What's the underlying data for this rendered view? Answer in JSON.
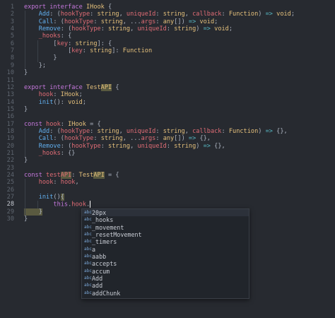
{
  "editor": {
    "active_line": 28,
    "lines": [
      {
        "n": "1",
        "s": [
          {
            "c": "kw",
            "t": "export interface "
          },
          {
            "c": "ty",
            "t": "IHook"
          },
          {
            "c": "pu",
            "t": " {"
          }
        ]
      },
      {
        "n": "2",
        "s": [
          {
            "c": "fn",
            "t": "    Add"
          },
          {
            "c": "pu",
            "t": ": ("
          },
          {
            "c": "pr",
            "t": "hookType"
          },
          {
            "c": "pu",
            "t": ": "
          },
          {
            "c": "ty",
            "t": "string"
          },
          {
            "c": "pu",
            "t": ", "
          },
          {
            "c": "pr",
            "t": "uniqueId"
          },
          {
            "c": "pu",
            "t": ": "
          },
          {
            "c": "ty",
            "t": "string"
          },
          {
            "c": "pu",
            "t": ", "
          },
          {
            "c": "pr",
            "t": "callback"
          },
          {
            "c": "pu",
            "t": ": "
          },
          {
            "c": "ty",
            "t": "Function"
          },
          {
            "c": "pu",
            "t": ") "
          },
          {
            "c": "op",
            "t": "=>"
          },
          {
            "c": "ty",
            "t": " void"
          },
          {
            "c": "pu",
            "t": ";"
          }
        ]
      },
      {
        "n": "3",
        "s": [
          {
            "c": "fn",
            "t": "    Call"
          },
          {
            "c": "pu",
            "t": ": ("
          },
          {
            "c": "pr",
            "t": "hookType"
          },
          {
            "c": "pu",
            "t": ": "
          },
          {
            "c": "ty",
            "t": "string"
          },
          {
            "c": "pu",
            "t": ", ..."
          },
          {
            "c": "pr",
            "t": "args"
          },
          {
            "c": "pu",
            "t": ": "
          },
          {
            "c": "ty",
            "t": "any"
          },
          {
            "c": "pu",
            "t": "[]) "
          },
          {
            "c": "op",
            "t": "=>"
          },
          {
            "c": "ty",
            "t": " void"
          },
          {
            "c": "pu",
            "t": ";"
          }
        ]
      },
      {
        "n": "4",
        "s": [
          {
            "c": "fn",
            "t": "    Remove"
          },
          {
            "c": "pu",
            "t": ": ("
          },
          {
            "c": "pr",
            "t": "hookType"
          },
          {
            "c": "pu",
            "t": ": "
          },
          {
            "c": "ty",
            "t": "string"
          },
          {
            "c": "pu",
            "t": ", "
          },
          {
            "c": "pr",
            "t": "uniqueId"
          },
          {
            "c": "pu",
            "t": ": "
          },
          {
            "c": "ty",
            "t": "string"
          },
          {
            "c": "pu",
            "t": ") "
          },
          {
            "c": "op",
            "t": "=>"
          },
          {
            "c": "ty",
            "t": " void"
          },
          {
            "c": "pu",
            "t": ";"
          }
        ]
      },
      {
        "n": "5",
        "s": [
          {
            "c": "pr",
            "t": "    _hooks"
          },
          {
            "c": "pu",
            "t": ": {"
          }
        ]
      },
      {
        "n": "6",
        "s": [
          {
            "c": "pu",
            "t": "        ["
          },
          {
            "c": "pr",
            "t": "key"
          },
          {
            "c": "pu",
            "t": ": "
          },
          {
            "c": "ty",
            "t": "string"
          },
          {
            "c": "pu",
            "t": "]: {"
          }
        ]
      },
      {
        "n": "7",
        "s": [
          {
            "c": "pu",
            "t": "            ["
          },
          {
            "c": "pr",
            "t": "key"
          },
          {
            "c": "pu",
            "t": ": "
          },
          {
            "c": "ty",
            "t": "string"
          },
          {
            "c": "pu",
            "t": "]: "
          },
          {
            "c": "ty",
            "t": "Function"
          }
        ]
      },
      {
        "n": "8",
        "s": [
          {
            "c": "pu",
            "t": "        }"
          }
        ]
      },
      {
        "n": "9",
        "s": [
          {
            "c": "pu",
            "t": "    };"
          }
        ]
      },
      {
        "n": "10",
        "s": [
          {
            "c": "pu",
            "t": "}"
          }
        ]
      },
      {
        "n": "11",
        "s": []
      },
      {
        "n": "12",
        "s": [
          {
            "c": "kw",
            "t": "export interface "
          },
          {
            "c": "ty",
            "t": "Test"
          },
          {
            "c": "ty hl",
            "t": "API"
          },
          {
            "c": "pu",
            "t": " {"
          }
        ]
      },
      {
        "n": "13",
        "s": [
          {
            "c": "pr",
            "t": "    hook"
          },
          {
            "c": "pu",
            "t": ": "
          },
          {
            "c": "ty",
            "t": "IHook"
          },
          {
            "c": "pu",
            "t": ";"
          }
        ]
      },
      {
        "n": "14",
        "s": [
          {
            "c": "fn",
            "t": "    init"
          },
          {
            "c": "pu",
            "t": "(): "
          },
          {
            "c": "ty",
            "t": "void"
          },
          {
            "c": "pu",
            "t": ";"
          }
        ]
      },
      {
        "n": "15",
        "s": [
          {
            "c": "pu",
            "t": "}"
          }
        ]
      },
      {
        "n": "16",
        "s": []
      },
      {
        "n": "17",
        "s": [
          {
            "c": "kw",
            "t": "const "
          },
          {
            "c": "pr",
            "t": "hook"
          },
          {
            "c": "pu",
            "t": ": "
          },
          {
            "c": "ty",
            "t": "IHook"
          },
          {
            "c": "pu",
            "t": " = {"
          }
        ]
      },
      {
        "n": "18",
        "s": [
          {
            "c": "fn",
            "t": "    Add"
          },
          {
            "c": "pu",
            "t": ": ("
          },
          {
            "c": "pr",
            "t": "hookType"
          },
          {
            "c": "pu",
            "t": ": "
          },
          {
            "c": "ty",
            "t": "string"
          },
          {
            "c": "pu",
            "t": ", "
          },
          {
            "c": "pr",
            "t": "uniqueId"
          },
          {
            "c": "pu",
            "t": ": "
          },
          {
            "c": "ty",
            "t": "string"
          },
          {
            "c": "pu",
            "t": ", "
          },
          {
            "c": "pr",
            "t": "callback"
          },
          {
            "c": "pu",
            "t": ": "
          },
          {
            "c": "ty",
            "t": "Function"
          },
          {
            "c": "pu",
            "t": ") "
          },
          {
            "c": "op",
            "t": "=>"
          },
          {
            "c": "pu",
            "t": " {},"
          }
        ]
      },
      {
        "n": "19",
        "s": [
          {
            "c": "fn",
            "t": "    Call"
          },
          {
            "c": "pu",
            "t": ": ("
          },
          {
            "c": "pr",
            "t": "hookType"
          },
          {
            "c": "pu",
            "t": ": "
          },
          {
            "c": "ty",
            "t": "string"
          },
          {
            "c": "pu",
            "t": ", ..."
          },
          {
            "c": "pr",
            "t": "args"
          },
          {
            "c": "pu",
            "t": ": "
          },
          {
            "c": "ty",
            "t": "any"
          },
          {
            "c": "pu",
            "t": "[]) "
          },
          {
            "c": "op",
            "t": "=>"
          },
          {
            "c": "pu",
            "t": " {},"
          }
        ]
      },
      {
        "n": "20",
        "s": [
          {
            "c": "fn",
            "t": "    Remove"
          },
          {
            "c": "pu",
            "t": ": ("
          },
          {
            "c": "pr",
            "t": "hookType"
          },
          {
            "c": "pu",
            "t": ": "
          },
          {
            "c": "ty",
            "t": "string"
          },
          {
            "c": "pu",
            "t": ", "
          },
          {
            "c": "pr",
            "t": "uniqueId"
          },
          {
            "c": "pu",
            "t": ": "
          },
          {
            "c": "ty",
            "t": "string"
          },
          {
            "c": "pu",
            "t": ") "
          },
          {
            "c": "op",
            "t": "=>"
          },
          {
            "c": "pu",
            "t": " {},"
          }
        ]
      },
      {
        "n": "21",
        "s": [
          {
            "c": "pr",
            "t": "    _hooks"
          },
          {
            "c": "pu",
            "t": ": {}"
          }
        ]
      },
      {
        "n": "22",
        "s": [
          {
            "c": "pu",
            "t": "}"
          }
        ]
      },
      {
        "n": "23",
        "s": []
      },
      {
        "n": "24",
        "s": [
          {
            "c": "kw",
            "t": "const "
          },
          {
            "c": "pr",
            "t": "test"
          },
          {
            "c": "pr hl",
            "t": "API"
          },
          {
            "c": "pu",
            "t": ": "
          },
          {
            "c": "ty",
            "t": "Test"
          },
          {
            "c": "ty hl",
            "t": "API"
          },
          {
            "c": "pu",
            "t": " = {"
          }
        ]
      },
      {
        "n": "25",
        "s": [
          {
            "c": "pr",
            "t": "    hook"
          },
          {
            "c": "pu",
            "t": ": "
          },
          {
            "c": "pr",
            "t": "hook"
          },
          {
            "c": "pu",
            "t": ","
          }
        ]
      },
      {
        "n": "26",
        "s": []
      },
      {
        "n": "27",
        "s": [
          {
            "c": "fn",
            "t": "    init"
          },
          {
            "c": "pu",
            "t": "()"
          },
          {
            "c": "pu hl",
            "t": "{"
          }
        ]
      },
      {
        "n": "28",
        "s": [
          {
            "c": "pu",
            "t": "        "
          },
          {
            "c": "kw",
            "t": "this"
          },
          {
            "c": "pu",
            "t": "."
          },
          {
            "c": "pr",
            "t": "hook"
          },
          {
            "c": "pu",
            "t": "."
          }
        ]
      },
      {
        "n": "29",
        "s": [
          {
            "c": "pu hl",
            "t": "    }"
          }
        ]
      },
      {
        "n": "30",
        "s": [
          {
            "c": "pu",
            "t": "}"
          }
        ]
      }
    ]
  },
  "suggestions": {
    "kind_label": "abc",
    "items": [
      "20px",
      "_hooks",
      "_movement",
      "_resetMovement",
      "_timers",
      "a",
      "aabb",
      "accepts",
      "accum",
      "Add",
      "add",
      "addChunk"
    ]
  },
  "colors": {
    "background": "#272a30",
    "keyword": "#c678dd",
    "type": "#e5c07b",
    "function": "#61afef",
    "property": "#e06c75",
    "operator": "#56b6c2"
  }
}
